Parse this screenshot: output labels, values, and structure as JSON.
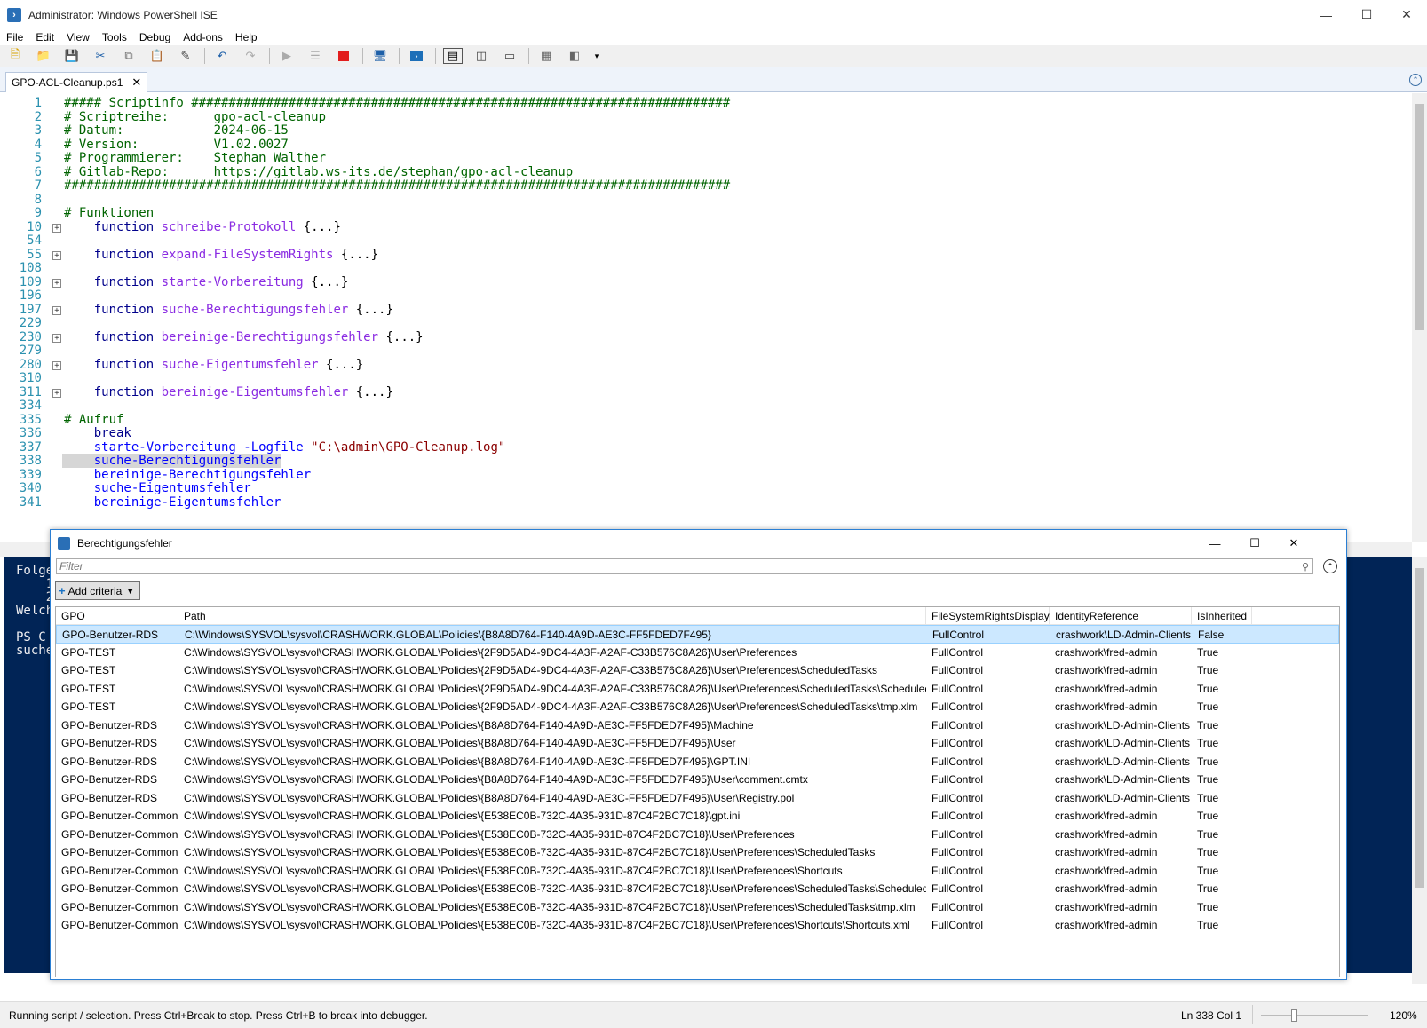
{
  "window": {
    "title": "Administrator: Windows PowerShell ISE"
  },
  "menu": [
    "File",
    "Edit",
    "View",
    "Tools",
    "Debug",
    "Add-ons",
    "Help"
  ],
  "tab": {
    "label": "GPO-ACL-Cleanup.ps1"
  },
  "code": {
    "lines": [
      {
        "n": "1",
        "text": "##### Scriptinfo ########################################################################",
        "type": "cmt"
      },
      {
        "n": "2",
        "text": "# Scriptreihe:      gpo-acl-cleanup",
        "type": "cmt"
      },
      {
        "n": "3",
        "text": "# Datum:            2024-06-15",
        "type": "cmt"
      },
      {
        "n": "4",
        "text": "# Version:          V1.02.0027",
        "type": "cmt"
      },
      {
        "n": "5",
        "text": "# Programmierer:    Stephan Walther",
        "type": "cmt"
      },
      {
        "n": "6",
        "text": "# Gitlab-Repo:      https://gitlab.ws-its.de/stephan/gpo-acl-cleanup",
        "type": "cmt"
      },
      {
        "n": "7",
        "text": "#########################################################################################",
        "type": "cmt"
      },
      {
        "n": "8",
        "text": "",
        "type": "plain"
      },
      {
        "n": "9",
        "text": "# Funktionen",
        "type": "cmt"
      },
      {
        "n": "10",
        "fold": true,
        "kw": "function",
        "fn": "schreibe-Protokoll",
        "rest": " {...}",
        "type": "func"
      },
      {
        "n": "54",
        "text": "",
        "type": "plain"
      },
      {
        "n": "55",
        "fold": true,
        "kw": "function",
        "fn": "expand-FileSystemRights",
        "rest": " {...}",
        "type": "func"
      },
      {
        "n": "108",
        "text": "",
        "type": "plain"
      },
      {
        "n": "109",
        "fold": true,
        "kw": "function",
        "fn": "starte-Vorbereitung",
        "rest": " {...}",
        "type": "func"
      },
      {
        "n": "196",
        "text": "",
        "type": "plain"
      },
      {
        "n": "197",
        "fold": true,
        "kw": "function",
        "fn": "suche-Berechtigungsfehler",
        "rest": " {...}",
        "type": "func"
      },
      {
        "n": "229",
        "text": "",
        "type": "plain"
      },
      {
        "n": "230",
        "fold": true,
        "kw": "function",
        "fn": "bereinige-Berechtigungsfehler",
        "rest": " {...}",
        "type": "func"
      },
      {
        "n": "279",
        "text": "",
        "type": "plain"
      },
      {
        "n": "280",
        "fold": true,
        "kw": "function",
        "fn": "suche-Eigentumsfehler",
        "rest": " {...}",
        "type": "func"
      },
      {
        "n": "310",
        "text": "",
        "type": "plain"
      },
      {
        "n": "311",
        "fold": true,
        "kw": "function",
        "fn": "bereinige-Eigentumsfehler",
        "rest": " {...}",
        "type": "func"
      },
      {
        "n": "334",
        "text": "",
        "type": "plain"
      },
      {
        "n": "335",
        "text": "# Aufruf",
        "type": "cmt"
      },
      {
        "n": "336",
        "text": "    break",
        "type": "kwline"
      },
      {
        "n": "337",
        "cmd": "    starte-Vorbereitung -Logfile ",
        "str": "\"C:\\admin\\GPO-Cleanup.log\"",
        "type": "cmdstr"
      },
      {
        "n": "338",
        "text": "    suche-Berechtigungsfehler",
        "type": "cmdhl"
      },
      {
        "n": "339",
        "text": "    bereinige-Berechtigungsfehler",
        "type": "cmd"
      },
      {
        "n": "340",
        "text": "    suche-Eigentumsfehler",
        "type": "cmd"
      },
      {
        "n": "341",
        "text": "    bereinige-Eigentumsfehler",
        "type": "cmd"
      }
    ]
  },
  "console": {
    "lines": [
      "Folge",
      "    1",
      "    2",
      "Welch",
      "",
      "PS C",
      "suche"
    ]
  },
  "gridview": {
    "title": "Berechtigungsfehler",
    "filter_placeholder": "Filter",
    "add_criteria": "Add criteria",
    "columns": [
      "GPO",
      "Path",
      "FileSystemRightsDisplay",
      "IdentityReference",
      "IsInherited"
    ],
    "rows": [
      [
        "GPO-Benutzer-RDS",
        "C:\\Windows\\SYSVOL\\sysvol\\CRASHWORK.GLOBAL\\Policies\\{B8A8D764-F140-4A9D-AE3C-FF5FDED7F495}",
        "FullControl",
        "crashwork\\LD-Admin-Clients",
        "False"
      ],
      [
        "GPO-TEST",
        "C:\\Windows\\SYSVOL\\sysvol\\CRASHWORK.GLOBAL\\Policies\\{2F9D5AD4-9DC4-4A3F-A2AF-C33B576C8A26}\\User\\Preferences",
        "FullControl",
        "crashwork\\fred-admin",
        "True"
      ],
      [
        "GPO-TEST",
        "C:\\Windows\\SYSVOL\\sysvol\\CRASHWORK.GLOBAL\\Policies\\{2F9D5AD4-9DC4-4A3F-A2AF-C33B576C8A26}\\User\\Preferences\\ScheduledTasks",
        "FullControl",
        "crashwork\\fred-admin",
        "True"
      ],
      [
        "GPO-TEST",
        "C:\\Windows\\SYSVOL\\sysvol\\CRASHWORK.GLOBAL\\Policies\\{2F9D5AD4-9DC4-4A3F-A2AF-C33B576C8A26}\\User\\Preferences\\ScheduledTasks\\ScheduledTasks.xml",
        "FullControl",
        "crashwork\\fred-admin",
        "True"
      ],
      [
        "GPO-TEST",
        "C:\\Windows\\SYSVOL\\sysvol\\CRASHWORK.GLOBAL\\Policies\\{2F9D5AD4-9DC4-4A3F-A2AF-C33B576C8A26}\\User\\Preferences\\ScheduledTasks\\tmp.xlm",
        "FullControl",
        "crashwork\\fred-admin",
        "True"
      ],
      [
        "GPO-Benutzer-RDS",
        "C:\\Windows\\SYSVOL\\sysvol\\CRASHWORK.GLOBAL\\Policies\\{B8A8D764-F140-4A9D-AE3C-FF5FDED7F495}\\Machine",
        "FullControl",
        "crashwork\\LD-Admin-Clients",
        "True"
      ],
      [
        "GPO-Benutzer-RDS",
        "C:\\Windows\\SYSVOL\\sysvol\\CRASHWORK.GLOBAL\\Policies\\{B8A8D764-F140-4A9D-AE3C-FF5FDED7F495}\\User",
        "FullControl",
        "crashwork\\LD-Admin-Clients",
        "True"
      ],
      [
        "GPO-Benutzer-RDS",
        "C:\\Windows\\SYSVOL\\sysvol\\CRASHWORK.GLOBAL\\Policies\\{B8A8D764-F140-4A9D-AE3C-FF5FDED7F495}\\GPT.INI",
        "FullControl",
        "crashwork\\LD-Admin-Clients",
        "True"
      ],
      [
        "GPO-Benutzer-RDS",
        "C:\\Windows\\SYSVOL\\sysvol\\CRASHWORK.GLOBAL\\Policies\\{B8A8D764-F140-4A9D-AE3C-FF5FDED7F495}\\User\\comment.cmtx",
        "FullControl",
        "crashwork\\LD-Admin-Clients",
        "True"
      ],
      [
        "GPO-Benutzer-RDS",
        "C:\\Windows\\SYSVOL\\sysvol\\CRASHWORK.GLOBAL\\Policies\\{B8A8D764-F140-4A9D-AE3C-FF5FDED7F495}\\User\\Registry.pol",
        "FullControl",
        "crashwork\\LD-Admin-Clients",
        "True"
      ],
      [
        "GPO-Benutzer-Common",
        "C:\\Windows\\SYSVOL\\sysvol\\CRASHWORK.GLOBAL\\Policies\\{E538EC0B-732C-4A35-931D-87C4F2BC7C18}\\gpt.ini",
        "FullControl",
        "crashwork\\fred-admin",
        "True"
      ],
      [
        "GPO-Benutzer-Common",
        "C:\\Windows\\SYSVOL\\sysvol\\CRASHWORK.GLOBAL\\Policies\\{E538EC0B-732C-4A35-931D-87C4F2BC7C18}\\User\\Preferences",
        "FullControl",
        "crashwork\\fred-admin",
        "True"
      ],
      [
        "GPO-Benutzer-Common",
        "C:\\Windows\\SYSVOL\\sysvol\\CRASHWORK.GLOBAL\\Policies\\{E538EC0B-732C-4A35-931D-87C4F2BC7C18}\\User\\Preferences\\ScheduledTasks",
        "FullControl",
        "crashwork\\fred-admin",
        "True"
      ],
      [
        "GPO-Benutzer-Common",
        "C:\\Windows\\SYSVOL\\sysvol\\CRASHWORK.GLOBAL\\Policies\\{E538EC0B-732C-4A35-931D-87C4F2BC7C18}\\User\\Preferences\\Shortcuts",
        "FullControl",
        "crashwork\\fred-admin",
        "True"
      ],
      [
        "GPO-Benutzer-Common",
        "C:\\Windows\\SYSVOL\\sysvol\\CRASHWORK.GLOBAL\\Policies\\{E538EC0B-732C-4A35-931D-87C4F2BC7C18}\\User\\Preferences\\ScheduledTasks\\ScheduledTasks.xml",
        "FullControl",
        "crashwork\\fred-admin",
        "True"
      ],
      [
        "GPO-Benutzer-Common",
        "C:\\Windows\\SYSVOL\\sysvol\\CRASHWORK.GLOBAL\\Policies\\{E538EC0B-732C-4A35-931D-87C4F2BC7C18}\\User\\Preferences\\ScheduledTasks\\tmp.xlm",
        "FullControl",
        "crashwork\\fred-admin",
        "True"
      ],
      [
        "GPO-Benutzer-Common",
        "C:\\Windows\\SYSVOL\\sysvol\\CRASHWORK.GLOBAL\\Policies\\{E538EC0B-732C-4A35-931D-87C4F2BC7C18}\\User\\Preferences\\Shortcuts\\Shortcuts.xml",
        "FullControl",
        "crashwork\\fred-admin",
        "True"
      ]
    ]
  },
  "status": {
    "message": "Running script / selection.  Press Ctrl+Break to stop.  Press Ctrl+B to break into debugger.",
    "position": "Ln 338  Col 1",
    "zoom": "120%"
  },
  "colors": {
    "console_bg": "#012456",
    "selection": "#cce8ff",
    "accent": "#2a7fd4"
  }
}
